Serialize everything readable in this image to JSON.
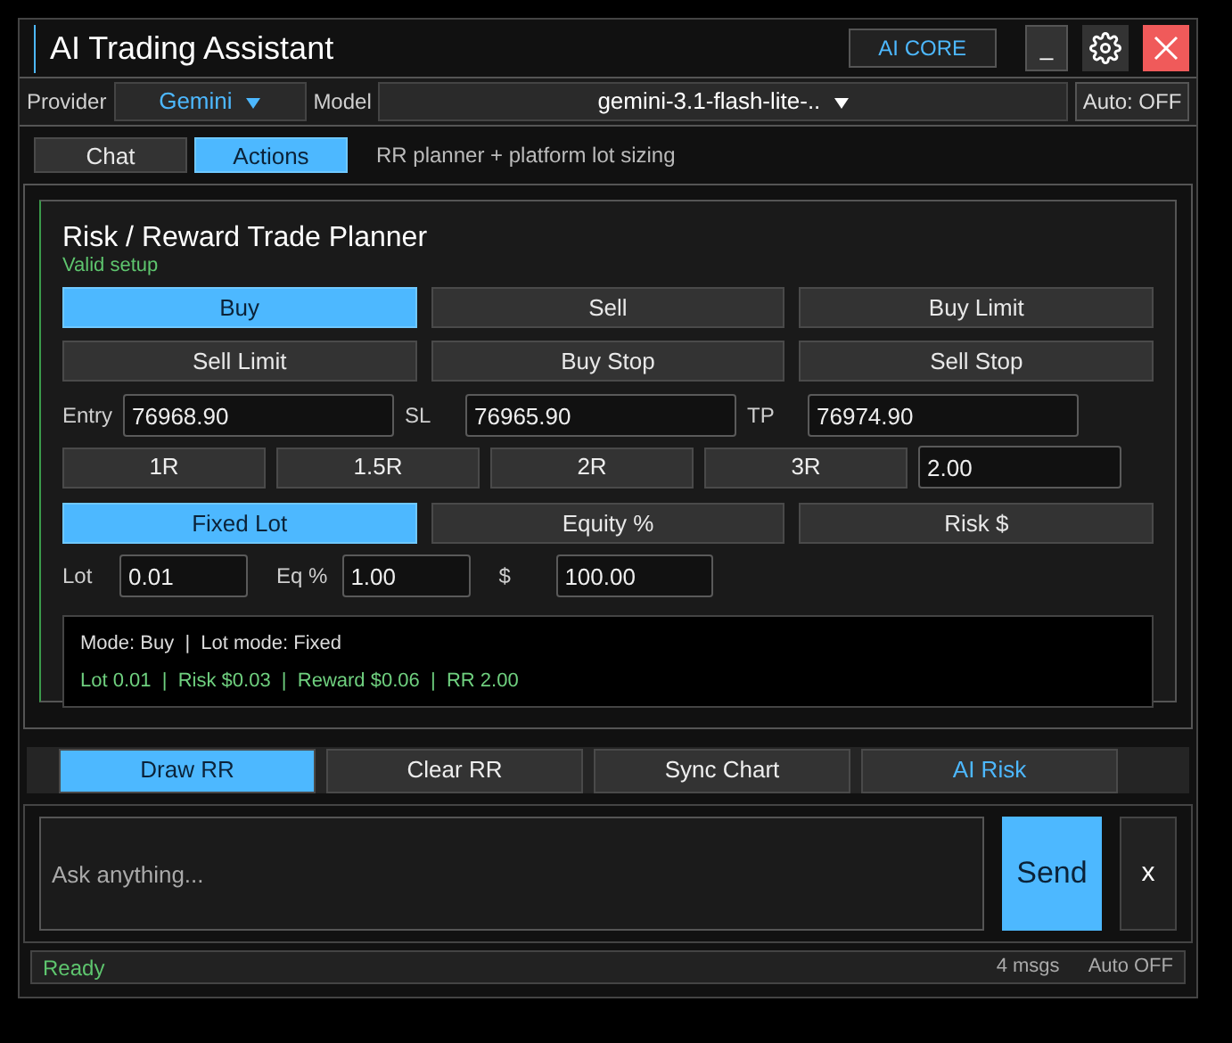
{
  "window": {
    "title": "AI Trading Assistant",
    "badge": "AI CORE",
    "minimize": "_"
  },
  "provider": {
    "label": "Provider",
    "value": "Gemini",
    "model_label": "Model",
    "model": "gemini-3.1-flash-lite-..",
    "auto": "Auto: OFF"
  },
  "tabs": [
    {
      "label": "Chat",
      "selected": false
    },
    {
      "label": "Actions",
      "selected": true
    }
  ],
  "tab_hint": "RR planner + platform lot sizing",
  "planner": {
    "title": "Risk / Reward Trade Planner",
    "status": "Valid setup",
    "order_types": [
      {
        "label": "Buy",
        "selected": true
      },
      {
        "label": "Sell",
        "selected": false
      },
      {
        "label": "Buy Limit",
        "selected": false
      },
      {
        "label": "Sell Limit",
        "selected": false
      },
      {
        "label": "Buy Stop",
        "selected": false
      },
      {
        "label": "Sell Stop",
        "selected": false
      }
    ],
    "prices": [
      {
        "label": "Entry",
        "value": "76968.90"
      },
      {
        "label": "SL",
        "value": "76965.90"
      },
      {
        "label": "TP",
        "value": "76974.90"
      }
    ],
    "rr_buttons": [
      "1R",
      "1.5R",
      "2R",
      "3R"
    ],
    "rr_value": "2.00",
    "lot_modes": [
      {
        "label": "Fixed Lot",
        "selected": true
      },
      {
        "label": "Equity %",
        "selected": false
      },
      {
        "label": "Risk $",
        "selected": false
      }
    ],
    "sizing": [
      {
        "label": "Lot",
        "value": "0.01"
      },
      {
        "label": "Eq %",
        "value": "1.00"
      },
      {
        "label": "$",
        "value": "100.00"
      }
    ],
    "summary_line": "Mode: Buy  |  Lot mode: Fixed",
    "result_line": "Lot 0.01  |  Risk $0.03  |  Reward $0.06  |  RR 2.00"
  },
  "actions": [
    {
      "label": "Draw RR",
      "kind": "primary"
    },
    {
      "label": "Clear RR",
      "kind": "normal"
    },
    {
      "label": "Sync Chart",
      "kind": "normal"
    },
    {
      "label": "AI Risk",
      "kind": "accent"
    }
  ],
  "chat": {
    "placeholder": "Ask anything...",
    "send": "Send",
    "clear": "x"
  },
  "status_bar": {
    "status": "Ready",
    "messages": "4 msgs",
    "auto": "Auto OFF"
  }
}
